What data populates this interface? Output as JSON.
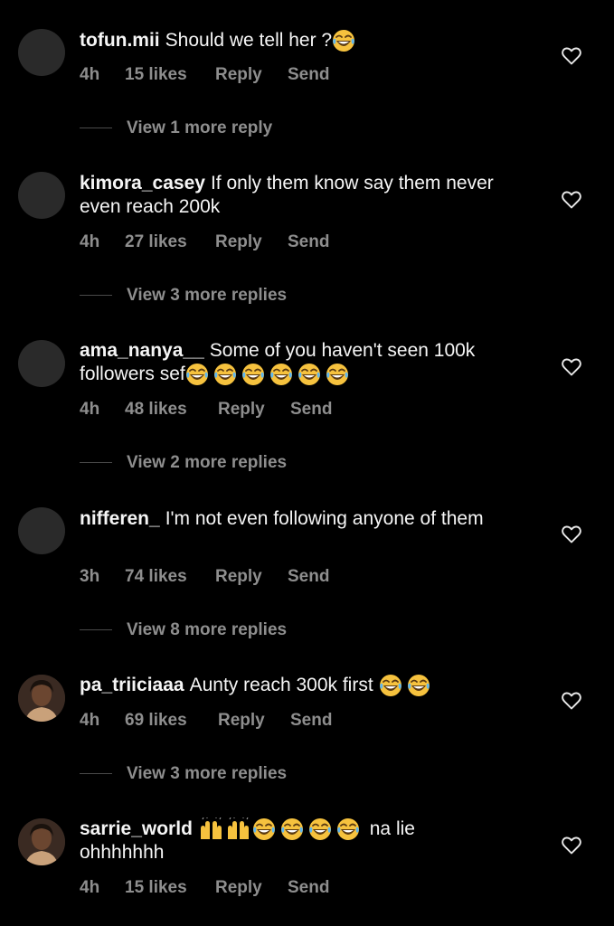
{
  "comments": [
    {
      "username": "tofun.mii",
      "text": "Should we tell her ?",
      "emojis": [
        "laugh"
      ],
      "time": "4h",
      "likes": "15 likes",
      "reply": "Reply",
      "send": "Send",
      "view_replies": "View 1 more reply",
      "avatar": "blank"
    },
    {
      "username": "kimora_casey",
      "text": "If only them know say them never even reach 200k",
      "emojis": [],
      "time": "4h",
      "likes": "27 likes",
      "reply": "Reply",
      "send": "Send",
      "view_replies": "View 3 more replies",
      "avatar": "blank"
    },
    {
      "username": "ama_nanya__",
      "text": "Some of you haven't seen 100k followers sef",
      "emojis": [
        "laugh",
        "laugh",
        "laugh",
        "laugh",
        "laugh",
        "laugh"
      ],
      "time": "4h",
      "likes": "48 likes",
      "reply": "Reply",
      "send": "Send",
      "view_replies": "View 2 more replies",
      "avatar": "blank"
    },
    {
      "username": "nifferen_",
      "text": "I'm not even following anyone of them",
      "emojis": [],
      "time": "3h",
      "likes": "74 likes",
      "reply": "Reply",
      "send": "Send",
      "view_replies": "View 8 more replies",
      "avatar": "blank"
    },
    {
      "username": "pa_triiciaaa",
      "text": "Aunty reach 300k first",
      "emojis": [
        "laugh",
        "laugh"
      ],
      "time": "4h",
      "likes": "69 likes",
      "reply": "Reply",
      "send": "Send",
      "view_replies": "View 3 more replies",
      "avatar": "photo"
    },
    {
      "username": "sarrie_world",
      "text": "na lie ohhhhhhh",
      "emojis": [
        "clap",
        "clap",
        "laugh",
        "laugh",
        "laugh",
        "laugh"
      ],
      "time": "4h",
      "likes": "15 likes",
      "reply": "Reply",
      "send": "Send",
      "view_replies": "",
      "avatar": "photo"
    }
  ],
  "icons": {
    "like": "heart-outline-icon",
    "laugh": "face-with-tears-of-joy-icon",
    "clap": "raising-hands-icon"
  },
  "colors": {
    "background": "#000000",
    "text": "#f5f5f5",
    "secondary": "#8e8e8e",
    "avatar_placeholder": "#2a2a2a",
    "emoji_yellow": "#f6c23e"
  }
}
